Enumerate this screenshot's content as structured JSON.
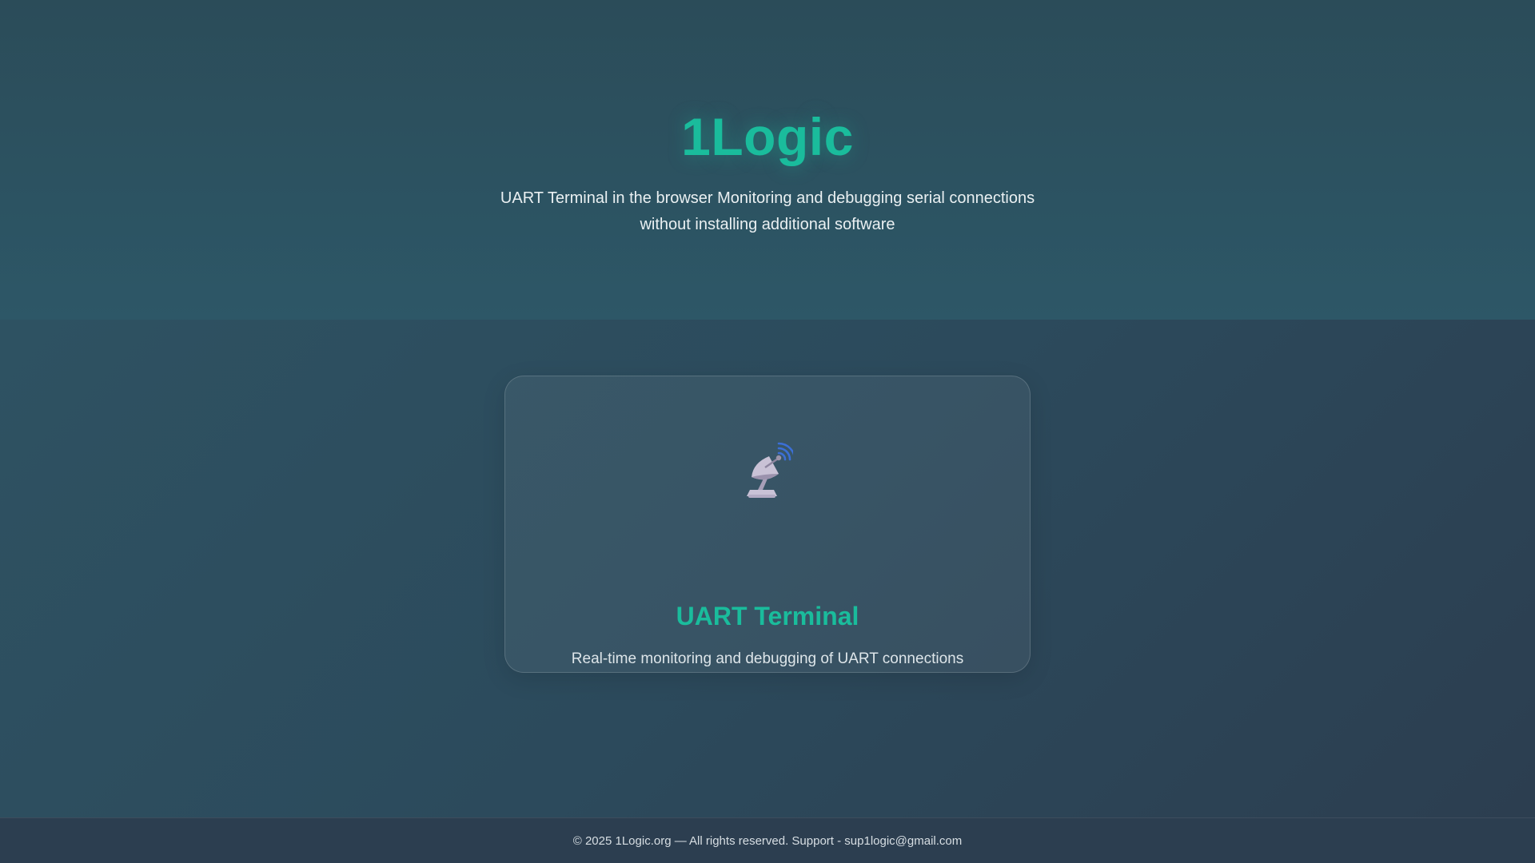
{
  "header": {
    "brand": "1Logic",
    "tagline": "UART Terminal in the browser Monitoring and debugging serial connections without installing additional software"
  },
  "card": {
    "icon": "satellite-antenna-icon",
    "title": "UART Terminal",
    "description": "Real-time monitoring and debugging of UART connections"
  },
  "footer": {
    "text": "© 2025 1Logic.org — All rights reserved. Support - sup1logic@gmail.com"
  },
  "colors": {
    "accent": "#1abc9c",
    "background": "#2c3e50"
  }
}
